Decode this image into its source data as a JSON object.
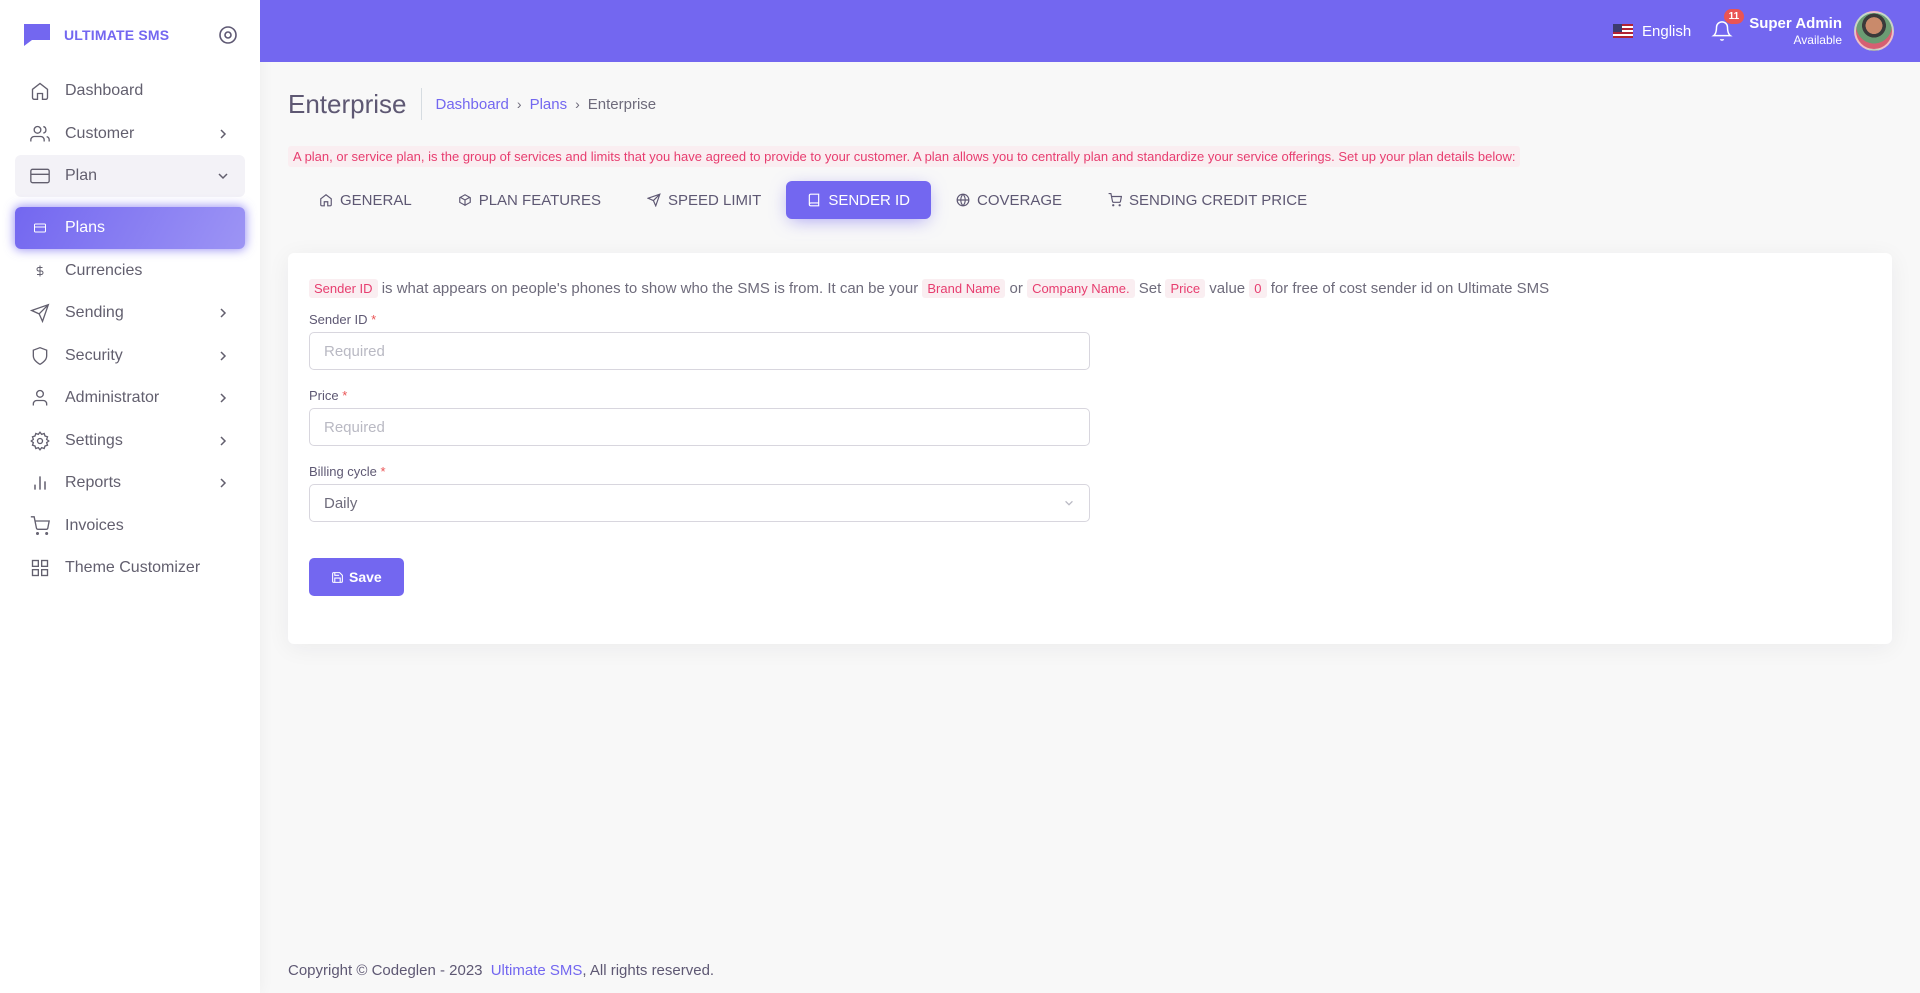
{
  "brand": {
    "name": "ULTIMATE SMS"
  },
  "sidebar": {
    "items": [
      {
        "label": "Dashboard",
        "icon": "home-icon"
      },
      {
        "label": "Customer",
        "icon": "users-icon"
      },
      {
        "label": "Plan",
        "icon": "credit-card-icon"
      },
      {
        "label": "Plans",
        "icon": "credit-card-icon"
      },
      {
        "label": "Currencies",
        "icon": "dollar-icon"
      },
      {
        "label": "Sending",
        "icon": "send-icon"
      },
      {
        "label": "Security",
        "icon": "shield-icon"
      },
      {
        "label": "Administrator",
        "icon": "user-icon"
      },
      {
        "label": "Settings",
        "icon": "gear-icon"
      },
      {
        "label": "Reports",
        "icon": "bar-chart-icon"
      },
      {
        "label": "Invoices",
        "icon": "shopping-cart-icon"
      },
      {
        "label": "Theme Customizer",
        "icon": "grid-icon"
      }
    ]
  },
  "navbar": {
    "language": "English",
    "notifications_count": "11",
    "user_name": "Super Admin",
    "user_status": "Available"
  },
  "page": {
    "title": "Enterprise",
    "breadcrumb": [
      "Dashboard",
      "Plans",
      "Enterprise"
    ],
    "notice": "A plan, or service plan, is the group of services and limits that you have agreed to provide to your customer. A plan allows you to centrally plan and standardize your service offerings. Set up your plan details below:"
  },
  "tabs": [
    {
      "label": "GENERAL",
      "icon": "home-icon"
    },
    {
      "label": "PLAN FEATURES",
      "icon": "box-icon"
    },
    {
      "label": "SPEED LIMIT",
      "icon": "send-icon"
    },
    {
      "label": "SENDER ID",
      "icon": "book-icon"
    },
    {
      "label": "COVERAGE",
      "icon": "globe-icon"
    },
    {
      "label": "SENDING CREDIT PRICE",
      "icon": "shopping-cart-icon"
    }
  ],
  "help": {
    "code1": "Sender ID",
    "text1": "is what appears on people's phones to show who the SMS is from. It can be your",
    "code2": "Brand Name",
    "text2": "or",
    "code3": "Company Name.",
    "text3": "Set",
    "code4": "Price",
    "text4": "value",
    "code5": "0",
    "text5": "for free of cost sender id on Ultimate SMS"
  },
  "form": {
    "sender_id_label": "Sender ID",
    "sender_id_placeholder": "Required",
    "price_label": "Price",
    "price_placeholder": "Required",
    "billing_label": "Billing cycle",
    "billing_value": "Daily",
    "required_mark": "*",
    "save_label": "Save"
  },
  "footer": {
    "text": "Copyright © Codeglen - 2023",
    "link": "Ultimate SMS",
    "suffix": ", All rights reserved."
  },
  "colors": {
    "accent": "#7367f0",
    "code_bg": "#faeef1",
    "code_text": "#e73d6f"
  }
}
